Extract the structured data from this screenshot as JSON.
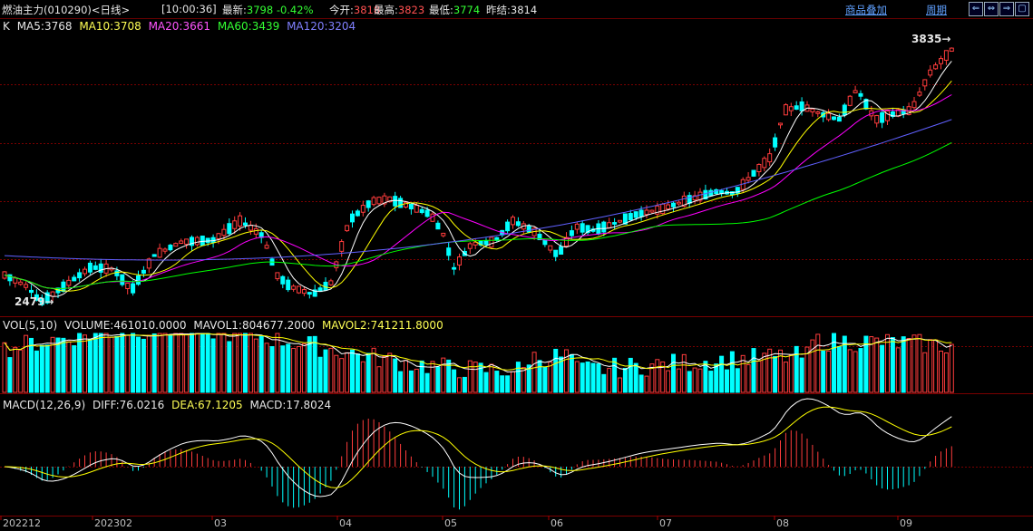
{
  "header": {
    "title": "燃油主力",
    "code": "(010290)",
    "period": "<日线>",
    "time": "[10:00:36]",
    "latest_label": "最新:",
    "latest_value": "3798",
    "change": "-0.42%",
    "open_label": "今开:",
    "open_value": "3818",
    "high_label": "最高:",
    "high_value": "3823",
    "low_label": "最低:",
    "low_value": "3774",
    "settle_label": "昨结:",
    "settle_value": "3814",
    "overlay_link": "商品叠加",
    "period_link": "周期"
  },
  "nav_buttons": [
    "⇐",
    "⇔",
    "⇒",
    "▢"
  ],
  "price_panel": {
    "k_label": "K",
    "ma5": "MA5:3768",
    "ma10": "MA10:3708",
    "ma20": "MA20:3661",
    "ma60": "MA60:3439",
    "ma120": "MA120:3204",
    "high_marker": "3835→",
    "low_marker": "2479→"
  },
  "volume_panel": {
    "label": "VOL(5,10)",
    "volume": "VOLUME:461010.0000",
    "mavol1": "MAVOL1:804677.2000",
    "mavol2": "MAVOL2:741211.8000"
  },
  "macd_panel": {
    "label": "MACD(12,26,9)",
    "diff": "DIFF:76.0216",
    "dea": "DEA:67.1205",
    "macd": "MACD:17.8024"
  },
  "x_axis": [
    "202212",
    "202302",
    "03",
    "04",
    "05",
    "06",
    "07",
    "08",
    "09"
  ],
  "colors": {
    "up": "#ff3c3c",
    "down": "#00ffff",
    "ma5": "#ffffff",
    "ma10": "#ffff00",
    "ma20": "#ff00ff",
    "ma60": "#00ff00",
    "ma120": "#6060ff",
    "grid": "#7a0000"
  }
}
